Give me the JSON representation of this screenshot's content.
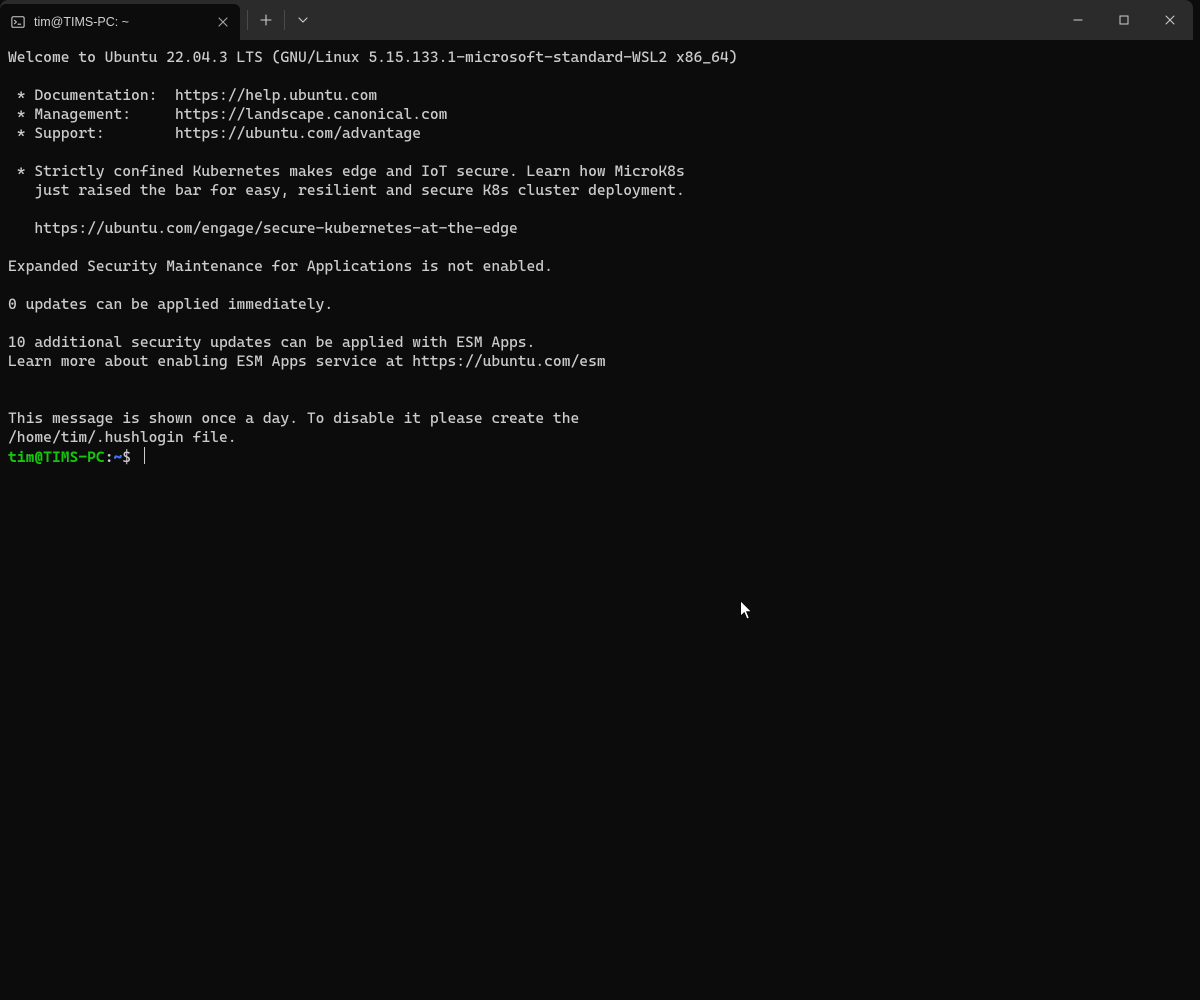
{
  "titlebar": {
    "tab_title": "tim@TIMS-PC: ~",
    "icons": {
      "terminal": "terminal-icon",
      "close_tab": "close-icon",
      "new_tab": "plus-icon",
      "dropdown": "chevron-down-icon",
      "minimize": "minimize-icon",
      "maximize": "maximize-icon",
      "close_win": "close-icon"
    }
  },
  "terminal": {
    "lines": [
      "Welcome to Ubuntu 22.04.3 LTS (GNU/Linux 5.15.133.1-microsoft-standard-WSL2 x86_64)",
      "",
      " * Documentation:  https://help.ubuntu.com",
      " * Management:     https://landscape.canonical.com",
      " * Support:        https://ubuntu.com/advantage",
      "",
      " * Strictly confined Kubernetes makes edge and IoT secure. Learn how MicroK8s",
      "   just raised the bar for easy, resilient and secure K8s cluster deployment.",
      "",
      "   https://ubuntu.com/engage/secure-kubernetes-at-the-edge",
      "",
      "Expanded Security Maintenance for Applications is not enabled.",
      "",
      "0 updates can be applied immediately.",
      "",
      "10 additional security updates can be applied with ESM Apps.",
      "Learn more about enabling ESM Apps service at https://ubuntu.com/esm",
      "",
      "",
      "This message is shown once a day. To disable it please create the",
      "/home/tim/.hushlogin file."
    ],
    "prompt": {
      "user_host": "tim@TIMS-PC",
      "separator": ":",
      "path": "~",
      "symbol": "$"
    }
  }
}
